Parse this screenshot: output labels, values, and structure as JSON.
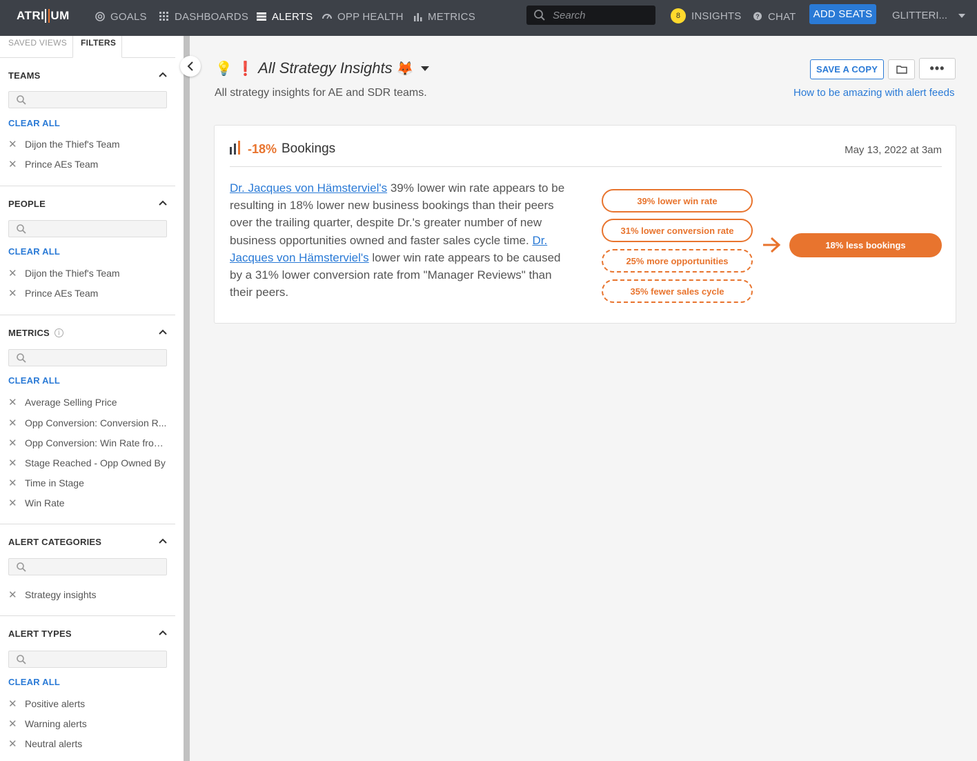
{
  "nav": {
    "logo": "ATRIUM",
    "items": [
      {
        "label": "GOALS",
        "icon": "goals-icon"
      },
      {
        "label": "DASHBOARDS",
        "icon": "grid-icon"
      },
      {
        "label": "ALERTS",
        "icon": "list-icon",
        "active": true
      },
      {
        "label": "OPP HEALTH",
        "icon": "gauge-icon"
      },
      {
        "label": "METRICS",
        "icon": "bar-chart-icon"
      }
    ],
    "search_placeholder": "Search",
    "insights_count": "8",
    "insights_label": "INSIGHTS",
    "chat_label": "CHAT",
    "add_seats": "ADD SEATS",
    "user": "GLITTERI..."
  },
  "sidebar": {
    "tabs": [
      "SAVED VIEWS",
      "FILTERS"
    ],
    "active_tab": "FILTERS",
    "clear_all": "CLEAR ALL",
    "sections": {
      "teams": {
        "title": "TEAMS",
        "chips": [
          "Dijon the Thief's Team",
          "Prince AEs Team"
        ]
      },
      "people": {
        "title": "PEOPLE",
        "chips": [
          "Dijon the Thief's Team",
          "Prince AEs Team"
        ]
      },
      "metrics": {
        "title": "METRICS",
        "info_icon": "i",
        "chips": [
          "Average Selling Price",
          "Opp Conversion: Conversion R...",
          "Opp Conversion: Win Rate from...",
          "Stage Reached - Opp Owned By",
          "Time in Stage",
          "Win Rate"
        ]
      },
      "categories": {
        "title": "ALERT CATEGORIES",
        "chips": [
          "Strategy insights"
        ]
      },
      "types": {
        "title": "ALERT TYPES",
        "chips": [
          "Positive alerts",
          "Warning alerts",
          "Neutral alerts"
        ]
      }
    }
  },
  "main": {
    "title_emoji": "💡 ❗",
    "title": "All Strategy Insights",
    "title_emoji_end": "🦊",
    "subtitle": "All strategy insights for AE and SDR teams.",
    "save_copy": "SAVE A COPY",
    "more": "•••",
    "howto": "How to be amazing with alert feeds"
  },
  "card": {
    "delta": "-18%",
    "metric": "Bookings",
    "date": "May 13, 2022 at 3am",
    "link1": "Dr. Jacques von Hämsterviel's",
    "text1": " 39% lower win rate appears to be resulting in 18% lower new business bookings than their peers over the trailing quarter, despite Dr.'s greater number of new business opportunities owned and faster sales cycle time. ",
    "link2": "Dr. Jacques von Hämsterviel's",
    "text2": " lower win rate appears to be caused by a 31% lower conversion rate from \"Manager Reviews\" than their peers.",
    "factors": [
      "39% lower win rate",
      "31% lower conversion rate",
      "25% more opportunities",
      "35% fewer sales cycle"
    ],
    "result": "18% less bookings"
  },
  "colors": {
    "accent_orange": "#e8742e",
    "link_blue": "#2a7ad6",
    "nav_bg": "#3d4148",
    "badge_yellow": "#ffd92d"
  }
}
